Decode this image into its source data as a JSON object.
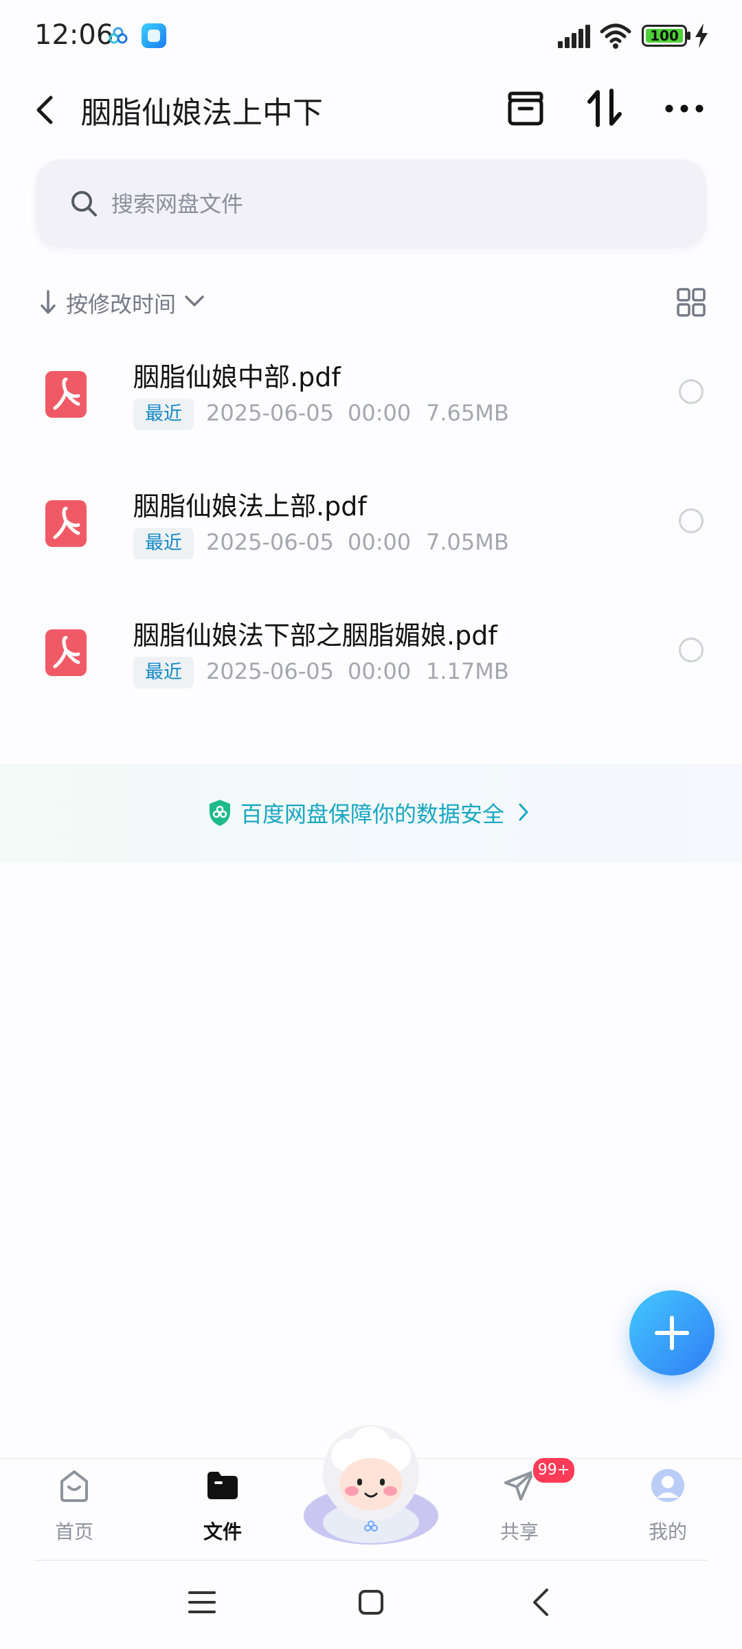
{
  "status_bar": {
    "time": "12:06",
    "battery": "100"
  },
  "header": {
    "title": "胭脂仙娘法上中下",
    "back_icon": "chevron-left-icon",
    "archive_icon": "archive-box-icon",
    "sort_icon": "sort-updown-icon",
    "more_icon": "more-dots-icon"
  },
  "search": {
    "placeholder": "搜索网盘文件"
  },
  "sort": {
    "label": "按修改时间"
  },
  "files": [
    {
      "name": "胭脂仙娘中部.pdf",
      "badge": "最近",
      "date": "2025-06-05",
      "time": "00:00",
      "size": "7.65MB"
    },
    {
      "name": "胭脂仙娘法上部.pdf",
      "badge": "最近",
      "date": "2025-06-05",
      "time": "00:00",
      "size": "7.05MB"
    },
    {
      "name": "胭脂仙娘法下部之胭脂媚娘.pdf",
      "badge": "最近",
      "date": "2025-06-05",
      "time": "00:00",
      "size": "1.17MB"
    }
  ],
  "security_banner": {
    "text": "百度网盘保障你的数据安全"
  },
  "tabs": [
    {
      "label": "首页",
      "icon": "home-icon"
    },
    {
      "label": "文件",
      "icon": "folder-icon"
    },
    {
      "label": "共享",
      "icon": "paper-plane-icon",
      "badge": "99+"
    },
    {
      "label": "我的",
      "icon": "avatar-icon"
    }
  ],
  "colors": {
    "accent": "#2f7df5",
    "security_text": "#17a6c2",
    "pdf_red": "#f05a66",
    "badge_red": "#ff3b57"
  }
}
